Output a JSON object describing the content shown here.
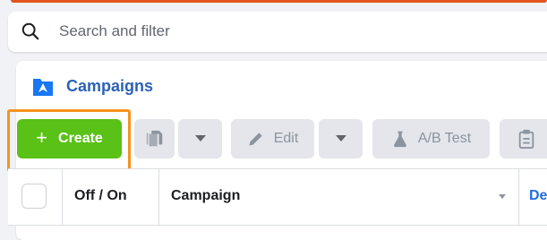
{
  "search": {
    "placeholder": "Search and filter"
  },
  "panel": {
    "title": "Campaigns"
  },
  "toolbar": {
    "create_label": "Create",
    "edit_label": "Edit",
    "abtest_label": "A/B Test"
  },
  "table": {
    "headers": {
      "toggle": "Off / On",
      "campaign": "Campaign",
      "next": "De"
    }
  },
  "colors": {
    "create_green": "#5ac117",
    "highlight_orange": "#f7931e",
    "title_blue": "#2b62b8"
  }
}
